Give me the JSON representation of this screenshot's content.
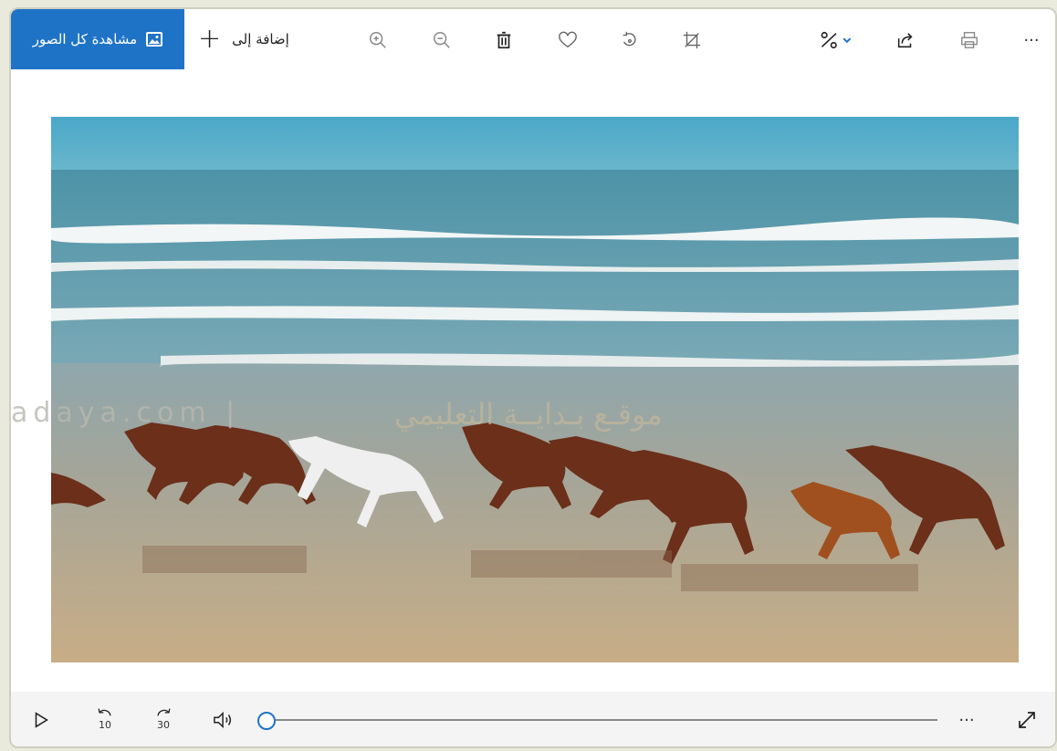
{
  "toolbar": {
    "view_all_label": "مشاهدة كل الصور",
    "add_to_label": "إضافة إلى",
    "plus_glyph": "+",
    "more_glyph": "···",
    "icons": [
      "zoom-in-icon",
      "zoom-out-icon",
      "delete-icon",
      "favorite-icon",
      "rotate-icon",
      "crop-icon",
      "edit-icon",
      "share-icon",
      "print-icon",
      "more-icon"
    ]
  },
  "watermark": {
    "domain_text": "adaya.com |",
    "arabic_text": "موقـع بـدايــة التعليمي"
  },
  "media": {
    "skip_back_label": "10",
    "skip_forward_label": "30",
    "more_glyph": "···",
    "progress": 0.0
  },
  "colors": {
    "accent": "#1f73c6",
    "sea": "#4d8fa6",
    "sky": "#4aa3c4",
    "sand": "#c8ad86"
  }
}
